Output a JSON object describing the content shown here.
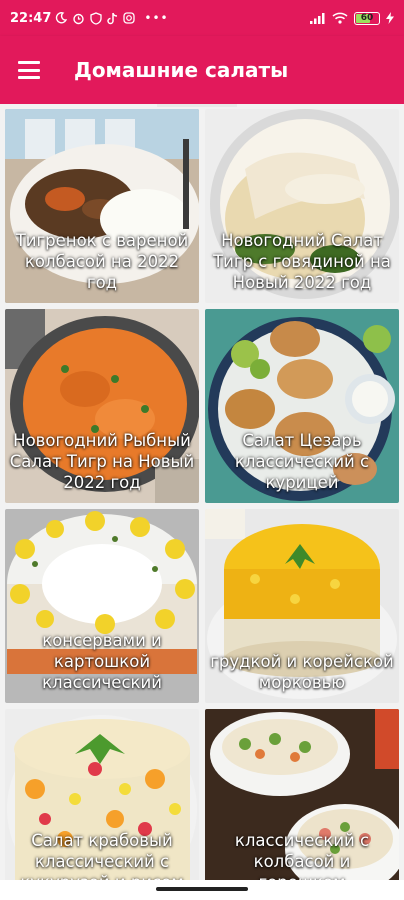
{
  "status_bar": {
    "time": "22:47",
    "left_icons": [
      "moon-icon",
      "alarm-icon",
      "shield-icon",
      "tiktok-icon",
      "instagram-icon",
      "more-dots-icon"
    ],
    "right_icons": [
      "signal-icon",
      "wifi-icon",
      "battery-icon",
      "charging-icon"
    ],
    "battery_level": "60"
  },
  "app_bar": {
    "menu_icon": "hamburger-icon",
    "title": "Домашние салаты"
  },
  "colors": {
    "accent": "#e2195b"
  },
  "recipes": [
    {
      "label": "Тигренок с вареной колбасой на 2022 год"
    },
    {
      "label": "Новогодний Салат Тигр с говядиной на Новый 2022 год"
    },
    {
      "label": "Новогодний Рыбный Салат Тигр на Новый 2022 год"
    },
    {
      "label": "Салат Цезарь классический с курицей"
    },
    {
      "label": "консервами и картошкой классический"
    },
    {
      "label": "грудкой и корейской морковью"
    },
    {
      "label": "Салат крабовый классический с кукурузой и рисом"
    },
    {
      "label": "классический с колбасой и горошком"
    }
  ]
}
